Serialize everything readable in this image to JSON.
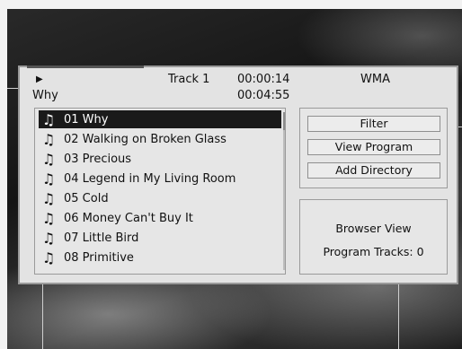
{
  "now_playing": {
    "play_icon": "play-icon",
    "track_label": "Track 1",
    "current_time": "00:00:14",
    "format": "WMA",
    "title": "Why",
    "total_time": "00:04:55"
  },
  "tracks": [
    {
      "label": "01 Why",
      "selected": true
    },
    {
      "label": "02 Walking on Broken Glass",
      "selected": false
    },
    {
      "label": "03 Precious",
      "selected": false
    },
    {
      "label": "04 Legend in My Living Room",
      "selected": false
    },
    {
      "label": "05 Cold",
      "selected": false
    },
    {
      "label": "06 Money Can't Buy It",
      "selected": false
    },
    {
      "label": "07 Little Bird",
      "selected": false
    },
    {
      "label": "08 Primitive",
      "selected": false
    }
  ],
  "buttons": {
    "filter": "Filter",
    "view_program": "View Program",
    "add_directory": "Add Directory"
  },
  "status": {
    "view_mode": "Browser View",
    "program_tracks": "Program Tracks: 0"
  },
  "icons": {
    "track": "music-note-icon"
  }
}
